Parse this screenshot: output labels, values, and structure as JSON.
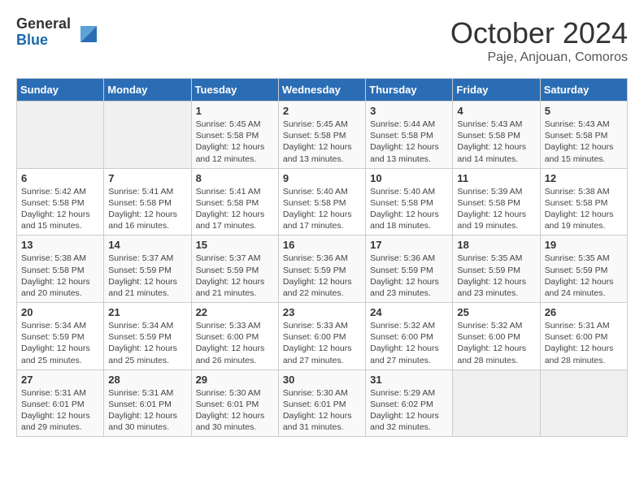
{
  "logo": {
    "general": "General",
    "blue": "Blue"
  },
  "title": "October 2024",
  "location": "Paje, Anjouan, Comoros",
  "days_header": [
    "Sunday",
    "Monday",
    "Tuesday",
    "Wednesday",
    "Thursday",
    "Friday",
    "Saturday"
  ],
  "weeks": [
    [
      {
        "day": "",
        "info": ""
      },
      {
        "day": "",
        "info": ""
      },
      {
        "day": "1",
        "info": "Sunrise: 5:45 AM\nSunset: 5:58 PM\nDaylight: 12 hours\nand 12 minutes."
      },
      {
        "day": "2",
        "info": "Sunrise: 5:45 AM\nSunset: 5:58 PM\nDaylight: 12 hours\nand 13 minutes."
      },
      {
        "day": "3",
        "info": "Sunrise: 5:44 AM\nSunset: 5:58 PM\nDaylight: 12 hours\nand 13 minutes."
      },
      {
        "day": "4",
        "info": "Sunrise: 5:43 AM\nSunset: 5:58 PM\nDaylight: 12 hours\nand 14 minutes."
      },
      {
        "day": "5",
        "info": "Sunrise: 5:43 AM\nSunset: 5:58 PM\nDaylight: 12 hours\nand 15 minutes."
      }
    ],
    [
      {
        "day": "6",
        "info": "Sunrise: 5:42 AM\nSunset: 5:58 PM\nDaylight: 12 hours\nand 15 minutes."
      },
      {
        "day": "7",
        "info": "Sunrise: 5:41 AM\nSunset: 5:58 PM\nDaylight: 12 hours\nand 16 minutes."
      },
      {
        "day": "8",
        "info": "Sunrise: 5:41 AM\nSunset: 5:58 PM\nDaylight: 12 hours\nand 17 minutes."
      },
      {
        "day": "9",
        "info": "Sunrise: 5:40 AM\nSunset: 5:58 PM\nDaylight: 12 hours\nand 17 minutes."
      },
      {
        "day": "10",
        "info": "Sunrise: 5:40 AM\nSunset: 5:58 PM\nDaylight: 12 hours\nand 18 minutes."
      },
      {
        "day": "11",
        "info": "Sunrise: 5:39 AM\nSunset: 5:58 PM\nDaylight: 12 hours\nand 19 minutes."
      },
      {
        "day": "12",
        "info": "Sunrise: 5:38 AM\nSunset: 5:58 PM\nDaylight: 12 hours\nand 19 minutes."
      }
    ],
    [
      {
        "day": "13",
        "info": "Sunrise: 5:38 AM\nSunset: 5:58 PM\nDaylight: 12 hours\nand 20 minutes."
      },
      {
        "day": "14",
        "info": "Sunrise: 5:37 AM\nSunset: 5:59 PM\nDaylight: 12 hours\nand 21 minutes."
      },
      {
        "day": "15",
        "info": "Sunrise: 5:37 AM\nSunset: 5:59 PM\nDaylight: 12 hours\nand 21 minutes."
      },
      {
        "day": "16",
        "info": "Sunrise: 5:36 AM\nSunset: 5:59 PM\nDaylight: 12 hours\nand 22 minutes."
      },
      {
        "day": "17",
        "info": "Sunrise: 5:36 AM\nSunset: 5:59 PM\nDaylight: 12 hours\nand 23 minutes."
      },
      {
        "day": "18",
        "info": "Sunrise: 5:35 AM\nSunset: 5:59 PM\nDaylight: 12 hours\nand 23 minutes."
      },
      {
        "day": "19",
        "info": "Sunrise: 5:35 AM\nSunset: 5:59 PM\nDaylight: 12 hours\nand 24 minutes."
      }
    ],
    [
      {
        "day": "20",
        "info": "Sunrise: 5:34 AM\nSunset: 5:59 PM\nDaylight: 12 hours\nand 25 minutes."
      },
      {
        "day": "21",
        "info": "Sunrise: 5:34 AM\nSunset: 5:59 PM\nDaylight: 12 hours\nand 25 minutes."
      },
      {
        "day": "22",
        "info": "Sunrise: 5:33 AM\nSunset: 6:00 PM\nDaylight: 12 hours\nand 26 minutes."
      },
      {
        "day": "23",
        "info": "Sunrise: 5:33 AM\nSunset: 6:00 PM\nDaylight: 12 hours\nand 27 minutes."
      },
      {
        "day": "24",
        "info": "Sunrise: 5:32 AM\nSunset: 6:00 PM\nDaylight: 12 hours\nand 27 minutes."
      },
      {
        "day": "25",
        "info": "Sunrise: 5:32 AM\nSunset: 6:00 PM\nDaylight: 12 hours\nand 28 minutes."
      },
      {
        "day": "26",
        "info": "Sunrise: 5:31 AM\nSunset: 6:00 PM\nDaylight: 12 hours\nand 28 minutes."
      }
    ],
    [
      {
        "day": "27",
        "info": "Sunrise: 5:31 AM\nSunset: 6:01 PM\nDaylight: 12 hours\nand 29 minutes."
      },
      {
        "day": "28",
        "info": "Sunrise: 5:31 AM\nSunset: 6:01 PM\nDaylight: 12 hours\nand 30 minutes."
      },
      {
        "day": "29",
        "info": "Sunrise: 5:30 AM\nSunset: 6:01 PM\nDaylight: 12 hours\nand 30 minutes."
      },
      {
        "day": "30",
        "info": "Sunrise: 5:30 AM\nSunset: 6:01 PM\nDaylight: 12 hours\nand 31 minutes."
      },
      {
        "day": "31",
        "info": "Sunrise: 5:29 AM\nSunset: 6:02 PM\nDaylight: 12 hours\nand 32 minutes."
      },
      {
        "day": "",
        "info": ""
      },
      {
        "day": "",
        "info": ""
      }
    ]
  ]
}
